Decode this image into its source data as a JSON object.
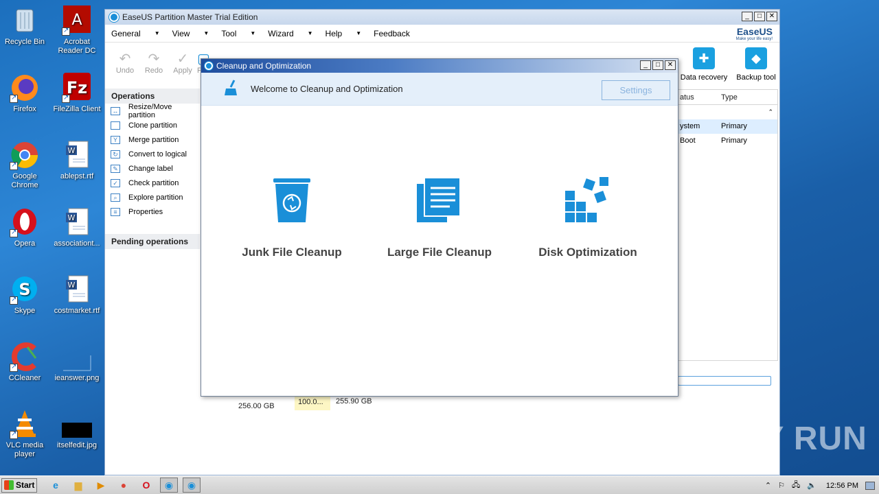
{
  "desktop_icons": [
    {
      "label": "Recycle Bin",
      "icon": "recycle-bin-icon"
    },
    {
      "label": "Acrobat Reader DC",
      "icon": "acrobat-icon"
    },
    {
      "label": "Firefox",
      "icon": "firefox-icon"
    },
    {
      "label": "FileZilla Client",
      "icon": "filezilla-icon"
    },
    {
      "label": "Google Chrome",
      "icon": "chrome-icon"
    },
    {
      "label": "ablepst.rtf",
      "icon": "word-doc-icon"
    },
    {
      "label": "Opera",
      "icon": "opera-icon"
    },
    {
      "label": "associationt...",
      "icon": "word-doc-icon"
    },
    {
      "label": "Skype",
      "icon": "skype-icon"
    },
    {
      "label": "costmarket.rtf",
      "icon": "word-doc-icon"
    },
    {
      "label": "CCleaner",
      "icon": "ccleaner-icon"
    },
    {
      "label": "ieanswer.png",
      "icon": "png-file-icon"
    },
    {
      "label": "VLC media player",
      "icon": "vlc-icon"
    },
    {
      "label": "itselfedit.jpg",
      "icon": "jpg-file-icon"
    }
  ],
  "main_window": {
    "title": "EaseUS Partition Master Trial Edition",
    "menu": [
      "General",
      "View",
      "Tool",
      "Wizard",
      "Help",
      "Feedback"
    ],
    "brand": {
      "name": "EaseUS",
      "tagline": "Make your life easy!"
    },
    "toolbar": [
      {
        "label": "Undo",
        "icon": "undo-icon"
      },
      {
        "label": "Redo",
        "icon": "redo-icon"
      },
      {
        "label": "Apply",
        "icon": "apply-icon"
      },
      {
        "label": "P",
        "icon": "partial-icon"
      }
    ],
    "operations_title": "Operations",
    "operations": [
      "Resize/Move partition",
      "Clone partition",
      "Merge partition",
      "Convert to logical",
      "Change label",
      "Check partition",
      "Explore partition",
      "Properties"
    ],
    "pending_title": "Pending operations",
    "right_tools": [
      {
        "label": "Data recovery",
        "icon": "data-recovery-icon"
      },
      {
        "label": "Backup tool",
        "icon": "backup-tool-icon"
      }
    ],
    "grid": {
      "headers": [
        "atus",
        "Type"
      ],
      "rows": [
        [
          "ystem",
          "Primary"
        ],
        [
          "Boot",
          "Primary"
        ]
      ]
    },
    "disk": {
      "size": "256.00 GB",
      "percent": "100.0...",
      "free": "255.90 GB"
    }
  },
  "dialog": {
    "title": "Cleanup and Optimization",
    "welcome": "Welcome to Cleanup and Optimization",
    "settings_label": "Settings",
    "features": [
      {
        "label": "Junk File Cleanup",
        "icon": "junk-file-cleanup-icon"
      },
      {
        "label": "Large File Cleanup",
        "icon": "large-file-cleanup-icon"
      },
      {
        "label": "Disk Optimization",
        "icon": "disk-optimization-icon"
      }
    ]
  },
  "taskbar": {
    "start_label": "Start",
    "time": "12:56 PM"
  },
  "watermark": "ANY RUN"
}
